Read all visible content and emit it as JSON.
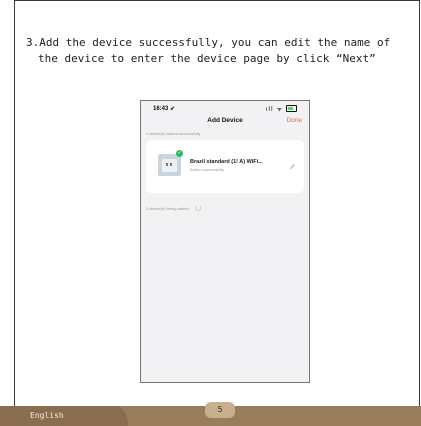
{
  "instruction": {
    "line1": "3.Add the device successfully, you can edit the name of",
    "line2": "the device to enter the device page by click “Next”"
  },
  "phone": {
    "status_bar": {
      "time": "16:43",
      "location_glyph": "➶",
      "signal_wifi_glyphs": "ıll ᯤ"
    },
    "nav": {
      "title": "Add Device",
      "done_label": "Done"
    },
    "added_label": "1 device(s) added successfully",
    "device": {
      "name": "Brazil standard (1!  A) WiFi...",
      "status": "Added successfully"
    },
    "pending_label": "0 device(s) being added"
  },
  "footer": {
    "language": "English",
    "page_number": "5"
  },
  "colors": {
    "accent_done": "#ff5a3a",
    "success_green": "#2fb66a",
    "footer_brown": "#9a7d5b"
  }
}
